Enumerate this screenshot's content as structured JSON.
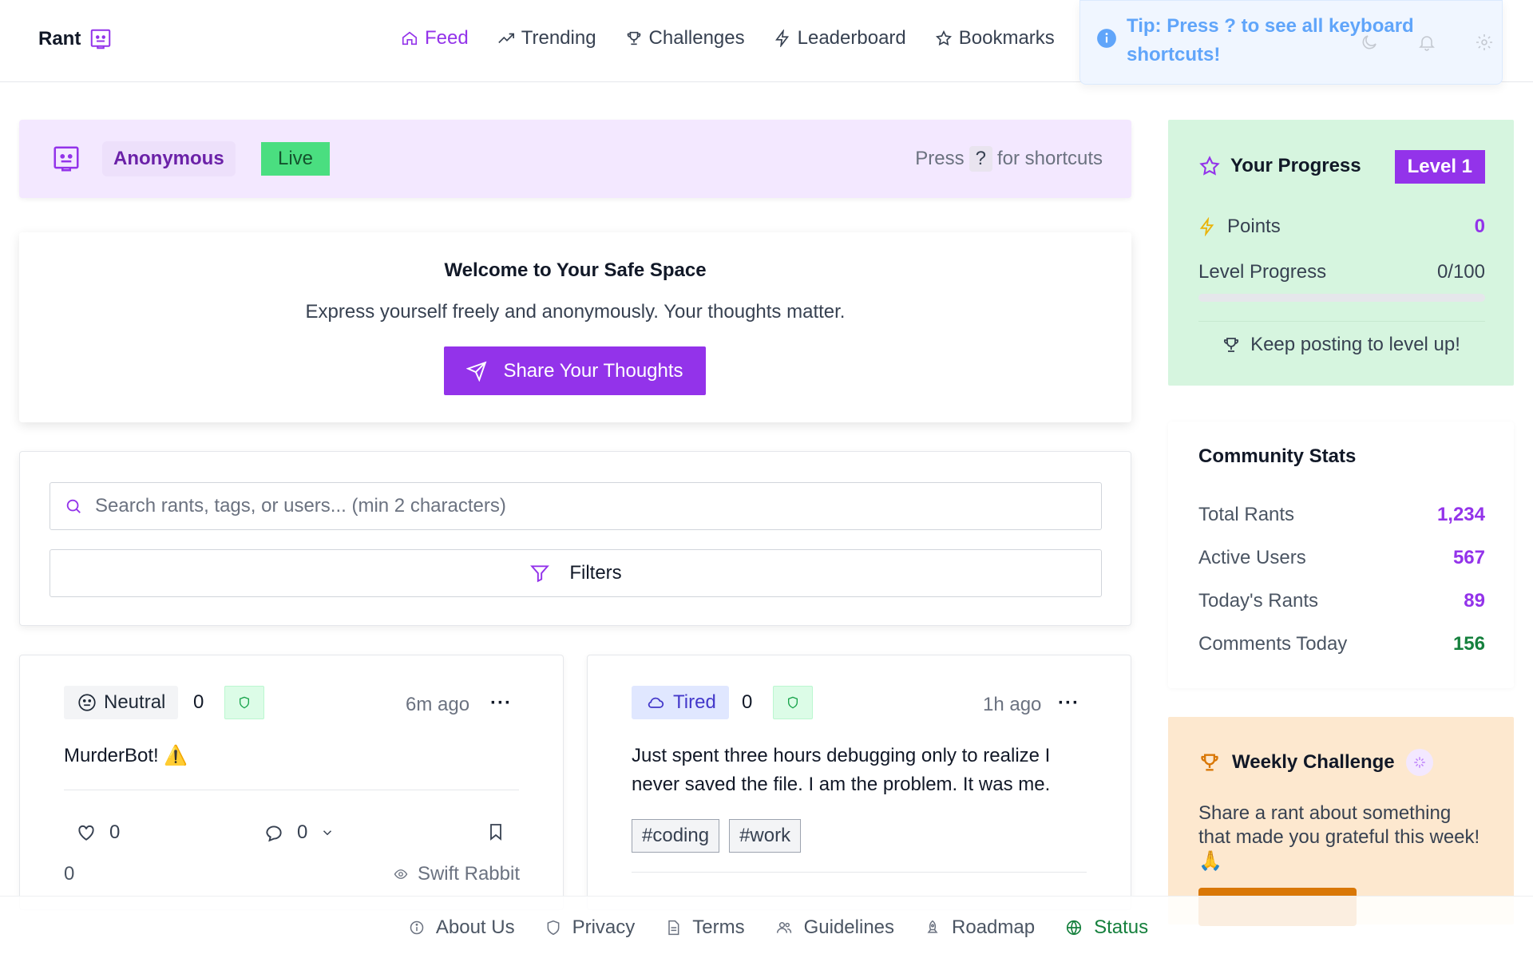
{
  "brand": {
    "name": "Rant"
  },
  "nav": {
    "items": [
      {
        "label": "Feed",
        "icon": "home-icon",
        "active": true
      },
      {
        "label": "Trending",
        "icon": "trending-icon"
      },
      {
        "label": "Challenges",
        "icon": "trophy-icon"
      },
      {
        "label": "Leaderboard",
        "icon": "zap-icon"
      },
      {
        "label": "Bookmarks",
        "icon": "star-icon"
      }
    ]
  },
  "tip": {
    "text": "Tip: Press ? to see all keyboard shortcuts!"
  },
  "userbar": {
    "username": "Anonymous",
    "status": "Live",
    "hint_prefix": "Press",
    "hint_key": "?",
    "hint_suffix": "for shortcuts"
  },
  "welcome": {
    "title": "Welcome to Your Safe Space",
    "subtitle": "Express yourself freely and anonymously. Your thoughts matter.",
    "cta": "Share Your Thoughts"
  },
  "search": {
    "placeholder": "Search rants, tags, or users... (min 2 characters)",
    "filters_label": "Filters"
  },
  "posts": [
    {
      "mood": "Neutral",
      "mood_count": "0",
      "time": "6m ago",
      "body": "MurderBot! ⚠️",
      "likes": "0",
      "comments": "0",
      "views": "0",
      "author": "Swift Rabbit",
      "more": "···"
    },
    {
      "mood": "Tired",
      "mood_count": "0",
      "time": "1h ago",
      "body": "Just spent three hours debugging only to realize I never saved the file. I am the problem. It was me.",
      "tags": [
        "#coding",
        "#work"
      ],
      "more": "···"
    }
  ],
  "progress": {
    "title": "Your Progress",
    "level": "Level 1",
    "points_label": "Points",
    "points_value": "0",
    "level_progress_label": "Level Progress",
    "level_progress_value": "0/100",
    "progress_fraction": 0,
    "footer": "Keep posting to level up!"
  },
  "stats": {
    "title": "Community Stats",
    "rows": [
      {
        "label": "Total Rants",
        "value": "1,234",
        "color": "#9333ea"
      },
      {
        "label": "Active Users",
        "value": "567",
        "color": "#9333ea"
      },
      {
        "label": "Today's Rants",
        "value": "89",
        "color": "#9333ea"
      },
      {
        "label": "Comments Today",
        "value": "156",
        "color": "#15803d"
      }
    ]
  },
  "challenge": {
    "title": "Weekly Challenge",
    "text": "Share a rant about something that made you grateful this week! 🙏"
  },
  "footer": {
    "links": [
      {
        "label": "About Us",
        "icon": "info-icon"
      },
      {
        "label": "Privacy",
        "icon": "shield-icon"
      },
      {
        "label": "Terms",
        "icon": "file-icon"
      },
      {
        "label": "Guidelines",
        "icon": "users-icon"
      },
      {
        "label": "Roadmap",
        "icon": "rocket-icon"
      },
      {
        "label": "Status",
        "icon": "globe-icon"
      }
    ]
  },
  "colors": {
    "accent": "#9333ea",
    "live": "#4ade80",
    "progress_bg": "#d6f5df",
    "challenge_bg": "#fde8cf"
  }
}
